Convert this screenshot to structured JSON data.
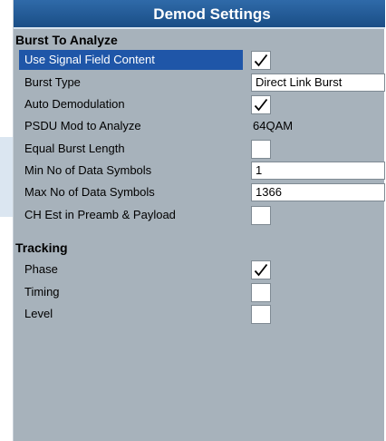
{
  "dialog": {
    "title": "Demod Settings"
  },
  "burst_section": {
    "heading": "Burst To Analyze",
    "use_signal_field_content": {
      "label": "Use Signal Field Content",
      "checked": true
    },
    "burst_type": {
      "label": "Burst Type",
      "value": "Direct Link Burst"
    },
    "auto_demodulation": {
      "label": "Auto Demodulation",
      "checked": true
    },
    "psdu_mod": {
      "label": "PSDU Mod to Analyze",
      "value": "64QAM"
    },
    "equal_burst_length": {
      "label": "Equal Burst Length",
      "checked": false
    },
    "min_data_symbols": {
      "label": "Min No of Data Symbols",
      "value": "1"
    },
    "max_data_symbols": {
      "label": "Max No of Data Symbols",
      "value": "1366"
    },
    "ch_est": {
      "label": "CH Est in Preamb & Payload",
      "checked": false
    }
  },
  "tracking_section": {
    "heading": "Tracking",
    "phase": {
      "label": "Phase",
      "checked": true
    },
    "timing": {
      "label": "Timing",
      "checked": false
    },
    "level": {
      "label": "Level",
      "checked": false
    }
  },
  "colors": {
    "titlebar": "#1f5590",
    "panel": "#a7b2bb",
    "selection": "#1f56a8"
  },
  "icons": {
    "checked": "checkmark-icon"
  }
}
